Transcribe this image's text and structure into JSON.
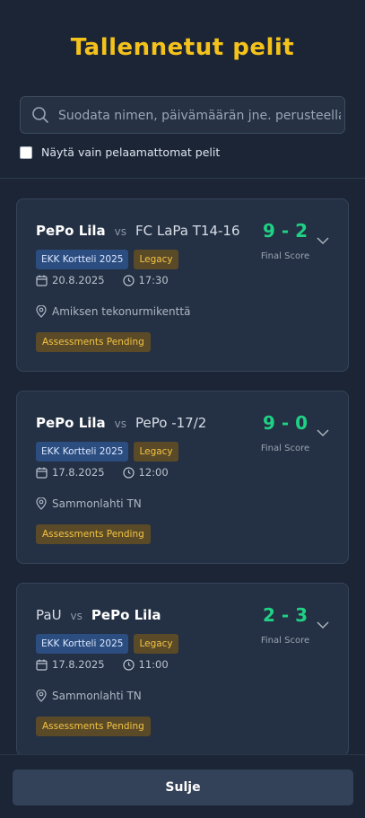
{
  "header": {
    "title": "Tallennetut pelit"
  },
  "search": {
    "placeholder": "Suodata nimen, päivämäärän jne. perusteella",
    "value": "",
    "icon": "search-icon"
  },
  "filter": {
    "label": "Näytä vain pelaamattomat pelit",
    "checked": false
  },
  "games": [
    {
      "home": "PePo Lila",
      "away": "FC LaPa T14-16",
      "bold_side": "home",
      "vs": "vs",
      "score": "9 - 2",
      "score_label": "Final Score",
      "series": "EKK Kortteli 2025",
      "tag": "Legacy",
      "date": "20.8.2025",
      "time": "17:30",
      "location": "Amiksen tekonurmikenttä",
      "status": "Assessments Pending"
    },
    {
      "home": "PePo Lila",
      "away": "PePo -17/2",
      "bold_side": "home",
      "vs": "vs",
      "score": "9 - 0",
      "score_label": "Final Score",
      "series": "EKK Kortteli 2025",
      "tag": "Legacy",
      "date": "17.8.2025",
      "time": "12:00",
      "location": "Sammonlahti TN",
      "status": "Assessments Pending"
    },
    {
      "home": "PaU",
      "away": "PePo Lila",
      "bold_side": "away",
      "vs": "vs",
      "score": "2 - 3",
      "score_label": "Final Score",
      "series": "EKK Kortteli 2025",
      "tag": "Legacy",
      "date": "17.8.2025",
      "time": "11:00",
      "location": "Sammonlahti TN",
      "status": "Assessments Pending"
    }
  ],
  "footer": {
    "close_label": "Sulje"
  },
  "colors": {
    "accent": "#f4c21b",
    "score": "#1fd184",
    "series_badge": "#2c4d7f",
    "legacy_badge": "#5b4a28"
  }
}
